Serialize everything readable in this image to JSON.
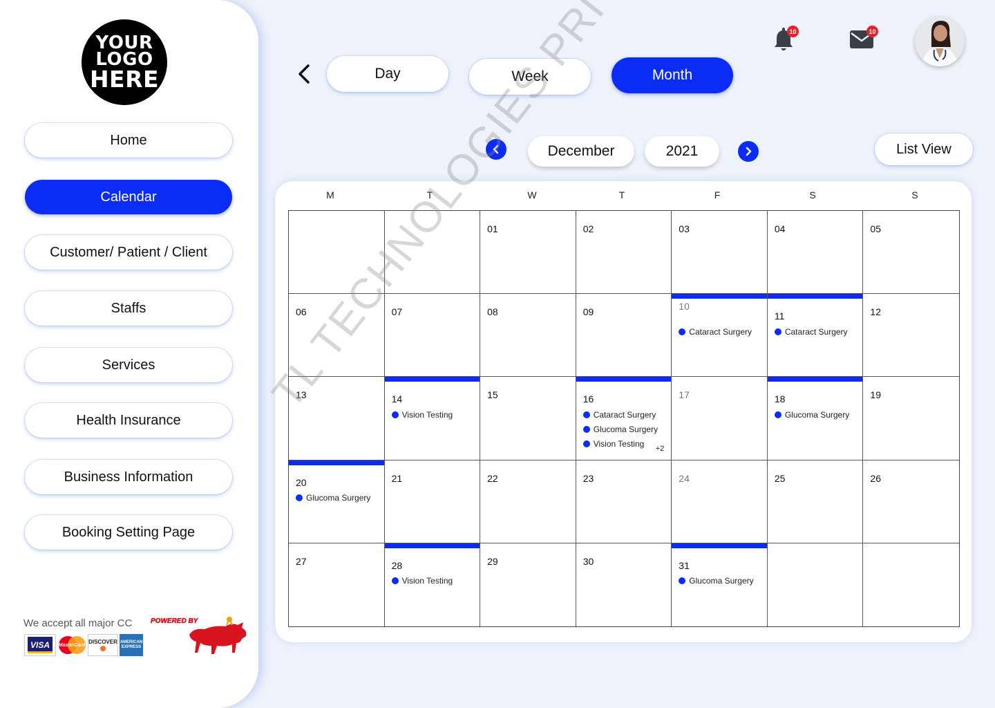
{
  "logo": {
    "line1": "YOUR",
    "line2": "LOGO",
    "line3": "HERE"
  },
  "sidebar": {
    "items": [
      {
        "label": "Home",
        "active": false
      },
      {
        "label": "Calendar",
        "active": true
      },
      {
        "label": "Customer/ Patient / Client",
        "active": false
      },
      {
        "label": "Staffs",
        "active": false
      },
      {
        "label": "Services",
        "active": false
      },
      {
        "label": "Health Insurance",
        "active": false
      },
      {
        "label": "Business Information",
        "active": false
      },
      {
        "label": "Booking Setting Page",
        "active": false
      }
    ],
    "cc_text": "We accept all major CC",
    "cards": [
      "VISA",
      "MasterCard",
      "DISCOVER",
      "AMERICAN EXPRESS"
    ],
    "powered_by": "POWERED BY"
  },
  "view_tabs": {
    "day": "Day",
    "week": "Week",
    "month": "Month",
    "active": "Month"
  },
  "notifications": {
    "bell_count": "10",
    "mail_count": "10"
  },
  "calendar": {
    "month": "December",
    "year": "2021",
    "list_view_label": "List View",
    "weekdays": [
      "M",
      "T",
      "W",
      "T",
      "F",
      "S",
      "S"
    ],
    "cells": [
      {
        "day": "",
        "booked": false,
        "muted": false,
        "events": []
      },
      {
        "day": "",
        "booked": false,
        "muted": false,
        "events": []
      },
      {
        "day": "01",
        "booked": false,
        "muted": false,
        "events": []
      },
      {
        "day": "02",
        "booked": false,
        "muted": false,
        "events": []
      },
      {
        "day": "03",
        "booked": false,
        "muted": false,
        "events": []
      },
      {
        "day": "04",
        "booked": false,
        "muted": false,
        "events": []
      },
      {
        "day": "05",
        "booked": false,
        "muted": false,
        "events": []
      },
      {
        "day": "06",
        "booked": false,
        "muted": false,
        "events": []
      },
      {
        "day": "07",
        "booked": false,
        "muted": false,
        "events": []
      },
      {
        "day": "08",
        "booked": false,
        "muted": false,
        "events": []
      },
      {
        "day": "09",
        "booked": false,
        "muted": false,
        "events": []
      },
      {
        "day": "10",
        "booked": true,
        "muted": true,
        "events": [
          "Cataract Surgery"
        ]
      },
      {
        "day": "11",
        "booked": true,
        "muted": false,
        "events": [
          "Cataract Surgery"
        ]
      },
      {
        "day": "12",
        "booked": false,
        "muted": false,
        "events": []
      },
      {
        "day": "13",
        "booked": false,
        "muted": false,
        "events": []
      },
      {
        "day": "14",
        "booked": true,
        "muted": false,
        "events": [
          "Vision Testing"
        ]
      },
      {
        "day": "15",
        "booked": false,
        "muted": false,
        "events": []
      },
      {
        "day": "16",
        "booked": true,
        "muted": false,
        "events": [
          "Cataract Surgery",
          "Glucoma Surgery",
          "Vision Testing"
        ],
        "more": "+2"
      },
      {
        "day": "17",
        "booked": false,
        "muted": true,
        "events": []
      },
      {
        "day": "18",
        "booked": true,
        "muted": false,
        "events": [
          "Glucoma Surgery"
        ]
      },
      {
        "day": "19",
        "booked": false,
        "muted": false,
        "events": []
      },
      {
        "day": "20",
        "booked": true,
        "muted": false,
        "events": [
          "Glucoma Surgery"
        ]
      },
      {
        "day": "21",
        "booked": false,
        "muted": false,
        "events": []
      },
      {
        "day": "22",
        "booked": false,
        "muted": false,
        "events": []
      },
      {
        "day": "23",
        "booked": false,
        "muted": false,
        "events": []
      },
      {
        "day": "24",
        "booked": false,
        "muted": true,
        "events": []
      },
      {
        "day": "25",
        "booked": false,
        "muted": false,
        "events": []
      },
      {
        "day": "26",
        "booked": false,
        "muted": false,
        "events": []
      },
      {
        "day": "27",
        "booked": false,
        "muted": false,
        "events": []
      },
      {
        "day": "28",
        "booked": true,
        "muted": false,
        "events": [
          "Vision Testing"
        ]
      },
      {
        "day": "29",
        "booked": false,
        "muted": false,
        "events": []
      },
      {
        "day": "30",
        "booked": false,
        "muted": false,
        "events": []
      },
      {
        "day": "31",
        "booked": true,
        "muted": false,
        "events": [
          "Glucoma Surgery"
        ]
      },
      {
        "day": "",
        "booked": false,
        "muted": false,
        "events": []
      },
      {
        "day": "",
        "booked": false,
        "muted": false,
        "events": []
      }
    ]
  },
  "watermark": "TL TECHNOLOGIES PRIVATE LIMITED",
  "colors": {
    "accent": "#0a2cf5",
    "badge": "#e6222a",
    "background": "#eef2fb"
  },
  "icons": [
    "back-arrow-icon",
    "bell-icon",
    "mail-icon",
    "prev-month-icon",
    "next-month-icon",
    "bull-logo-icon"
  ]
}
